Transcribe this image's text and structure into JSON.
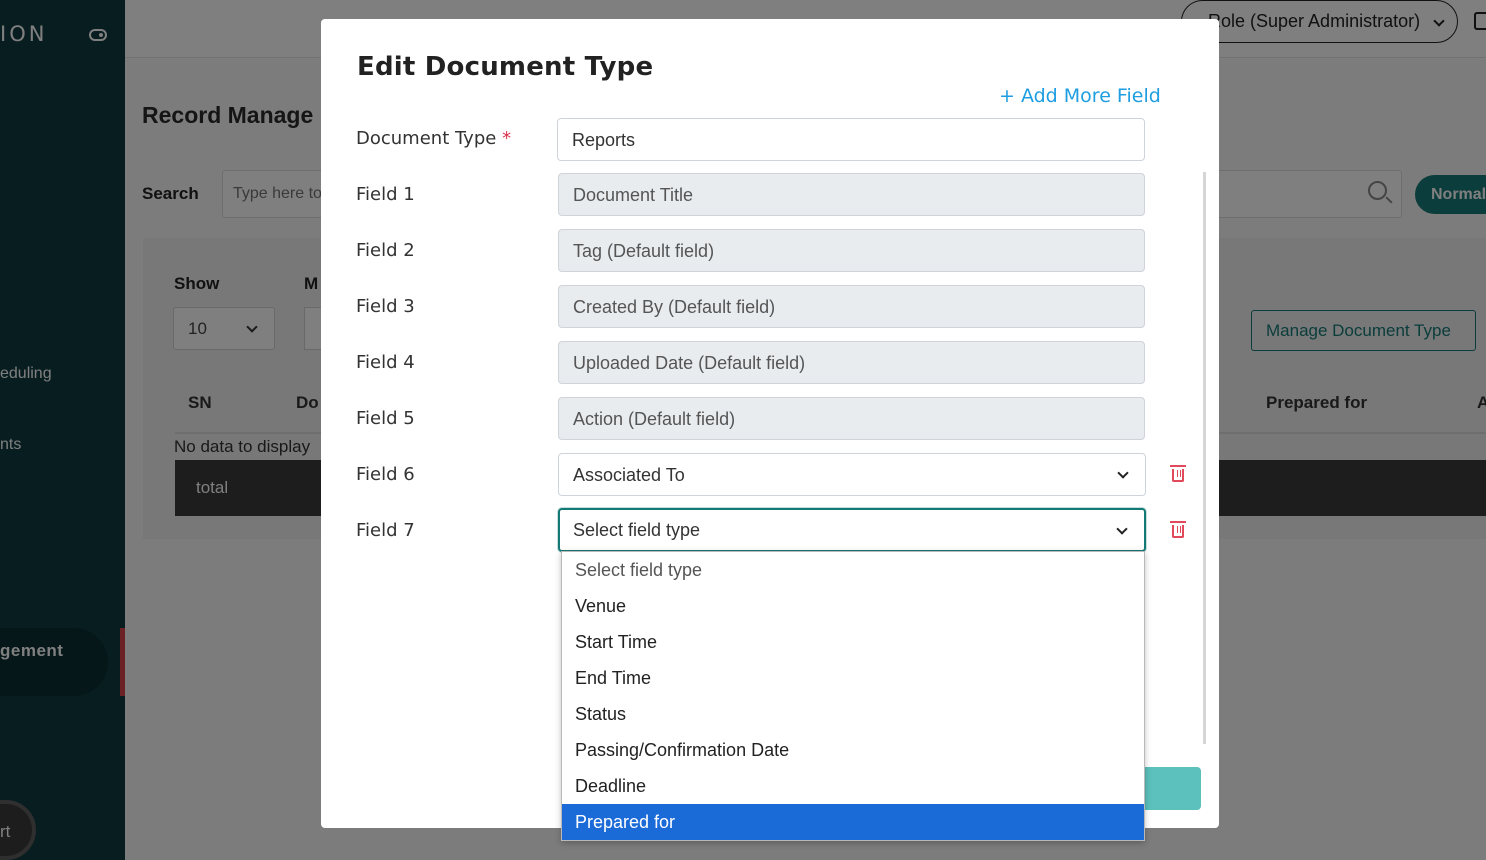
{
  "sidebar": {
    "logo": "ION",
    "items": [
      "eduling",
      "nts"
    ],
    "active_item": "gement",
    "support": "rt"
  },
  "topbar": {
    "role": "Role (Super Administrator)"
  },
  "page": {
    "title": "Record Manage",
    "search_label": "Search",
    "search_placeholder": "Type here to",
    "normal_button": "Normal",
    "show_label": "Show",
    "m_label": "M",
    "show_value": "10",
    "manage_button": "Manage Document Type",
    "table_headers": [
      "SN",
      "Do",
      "Prepared for",
      "A"
    ],
    "no_data": "No data to display",
    "total": "total"
  },
  "modal": {
    "title": "Edit Document Type",
    "add_more": "+ Add More Field",
    "document_type_label": "Document Type",
    "required_mark": "*",
    "document_type_value": "Reports",
    "fields": [
      {
        "label": "Field 1",
        "value": "Document Title"
      },
      {
        "label": "Field 2",
        "value": "Tag (Default field)"
      },
      {
        "label": "Field 3",
        "value": "Created By (Default field)"
      },
      {
        "label": "Field 4",
        "value": "Uploaded Date (Default field)"
      },
      {
        "label": "Field 5",
        "value": "Action (Default field)"
      },
      {
        "label": "Field 6",
        "value": "Associated To"
      },
      {
        "label": "Field 7",
        "value": "Select field type"
      }
    ]
  },
  "dropdown": {
    "options": [
      "Select field type",
      "Venue",
      "Start Time",
      "End Time",
      "Status",
      "Passing/Confirmation Date",
      "Deadline",
      "Prepared for"
    ],
    "selected": "Prepared for"
  },
  "colors": {
    "accent": "#157a76",
    "link": "#1e9ee0",
    "danger": "#e04a5a",
    "sidebar": "#103a40",
    "highlight": "#1a6ad8"
  }
}
